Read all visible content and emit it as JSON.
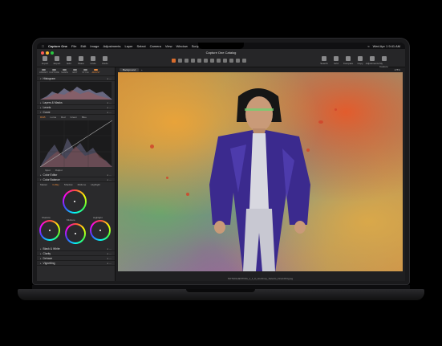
{
  "menubar": {
    "app": "Capture One",
    "items": [
      "File",
      "Edit",
      "Image",
      "Adjustments",
      "Layer",
      "Select",
      "Camera",
      "View",
      "Window",
      "Scripts",
      "Help"
    ],
    "clock": "Wed Apr 1  9:41 AM"
  },
  "window": {
    "title": "Capture One Catalog"
  },
  "toolbar": {
    "left": [
      "Import",
      "Export",
      "Edit",
      "Share",
      "Undo",
      "Redo"
    ],
    "center_label": "Cursor Tools",
    "right": [
      "Search",
      "Grid",
      "Compare",
      "Copy",
      "Adjustments",
      "My Capture One"
    ]
  },
  "sidebar": {
    "tabs": [
      "LIBRARY",
      "CAPTURE",
      "SHAPE",
      "EDIT",
      "STYLE",
      "ADJUST"
    ],
    "active_tab": "ADJUST",
    "sections": {
      "histogram": "Histogram",
      "layers": "Layers & Masks",
      "levels": "Levels",
      "curve": "Curve",
      "color_editor": "Color Editor",
      "color_balance": "Color Balance",
      "black_white": "Black & White",
      "clarity": "Clarity",
      "dehaze": "Dehaze",
      "vignetting": "Vignetting"
    },
    "curve_tabs": [
      "RGB",
      "Luma",
      "Red",
      "Green",
      "Blue"
    ],
    "curve_io": [
      "Input",
      "Output"
    ],
    "balance_tabs": [
      "Master",
      "3-Way",
      "Shadow",
      "Midtone",
      "Highlight"
    ],
    "wheel_labels": [
      "Shadow",
      "Midtone",
      "Highlight"
    ]
  },
  "viewer": {
    "layer": "Background",
    "zoom": "178%",
    "filename": "NOTHIGHESTING_1_1_0_Hocktney_Selects_Final-004.jpeg"
  },
  "colors": {
    "accent": "#e88a3d",
    "jacket": "#3b2a8e"
  }
}
